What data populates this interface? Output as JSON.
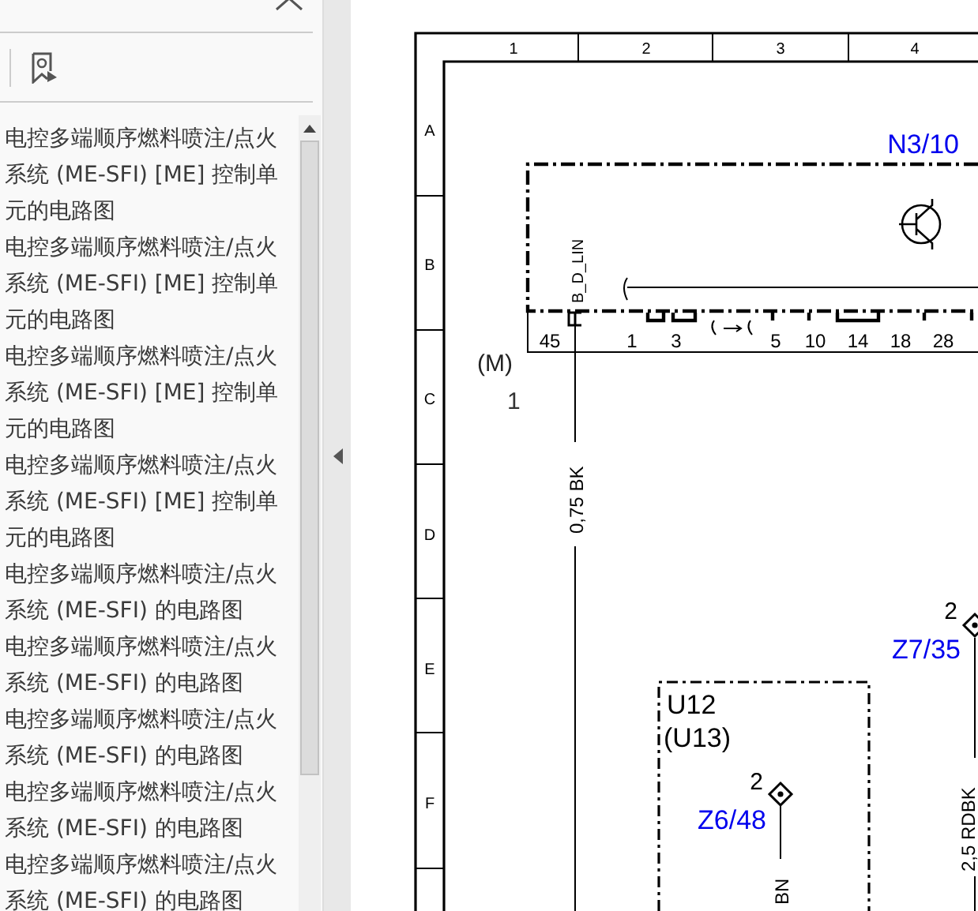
{
  "sidebar": {
    "bookmarks": [
      {
        "title": "电控多端顺序燃料喷注/点火系统 (ME-SFI) [ME] 控制单元的电路图"
      },
      {
        "title": "电控多端顺序燃料喷注/点火系统 (ME-SFI) [ME] 控制单元的电路图"
      },
      {
        "title": "电控多端顺序燃料喷注/点火系统 (ME-SFI) [ME] 控制单元的电路图"
      },
      {
        "title": "电控多端顺序燃料喷注/点火系统 (ME-SFI) [ME] 控制单元的电路图"
      },
      {
        "title": "电控多端顺序燃料喷注/点火系统 (ME-SFI) 的电路图"
      },
      {
        "title": "电控多端顺序燃料喷注/点火系统 (ME-SFI) 的电路图"
      },
      {
        "title": "电控多端顺序燃料喷注/点火系统 (ME-SFI) 的电路图"
      },
      {
        "title": "电控多端顺序燃料喷注/点火系统 (ME-SFI) 的电路图"
      },
      {
        "title": "电控多端顺序燃料喷注/点火系统 (ME-SFI) 的电路图"
      }
    ]
  },
  "diagram": {
    "columns": [
      "1",
      "2",
      "3",
      "4"
    ],
    "rows": [
      "A",
      "B",
      "C",
      "D",
      "E",
      "F"
    ],
    "component": "N3/10",
    "pins": [
      "45",
      "1",
      "3",
      "5",
      "10",
      "14",
      "18",
      "28"
    ],
    "signal": "B_D_LIN",
    "ground_label": "(M)",
    "ground_number": "1",
    "wire_1": "0,75 BK",
    "connector_1": {
      "pin": "2",
      "name": "Z7/35"
    },
    "wire_2": "2,5 RDBK",
    "module": {
      "name": "U12",
      "alt": "(U13)"
    },
    "connector_2": {
      "pin": "2",
      "name": "Z6/48"
    },
    "wire_3": "BN"
  }
}
